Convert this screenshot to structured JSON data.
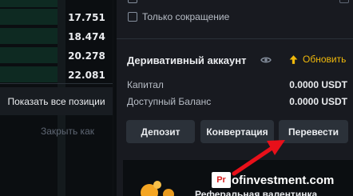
{
  "order_book": {
    "prices": [
      "",
      "17.751",
      "18.474",
      "20.278",
      "22.081"
    ],
    "depth": [
      0.55,
      0.55,
      0.55,
      0.55,
      0.55
    ]
  },
  "positions": {
    "show_all_label": "Показать все позиции",
    "close_as_label": "Закрыть как"
  },
  "filters": {
    "only_reduce_label": "Только сокращение"
  },
  "derivatives": {
    "title": "Деривативный аккаунт",
    "refresh_label": "Обновить",
    "capital_label": "Капитал",
    "capital_value": "0.0000 USDT",
    "available_label": "Доступный Баланс",
    "available_value": "0.0000 USDT"
  },
  "actions": {
    "deposit_label": "Депозит",
    "convert_label": "Конвертация",
    "transfer_label": "Перевести"
  },
  "promo": {
    "text": "Реферальная валентинка"
  },
  "watermark": {
    "badge": "Pr",
    "text": "ofinvestment.com"
  },
  "colors": {
    "accent": "#f0b90b",
    "arrow": "#e8101a",
    "depth_green": "#0e2a22"
  }
}
